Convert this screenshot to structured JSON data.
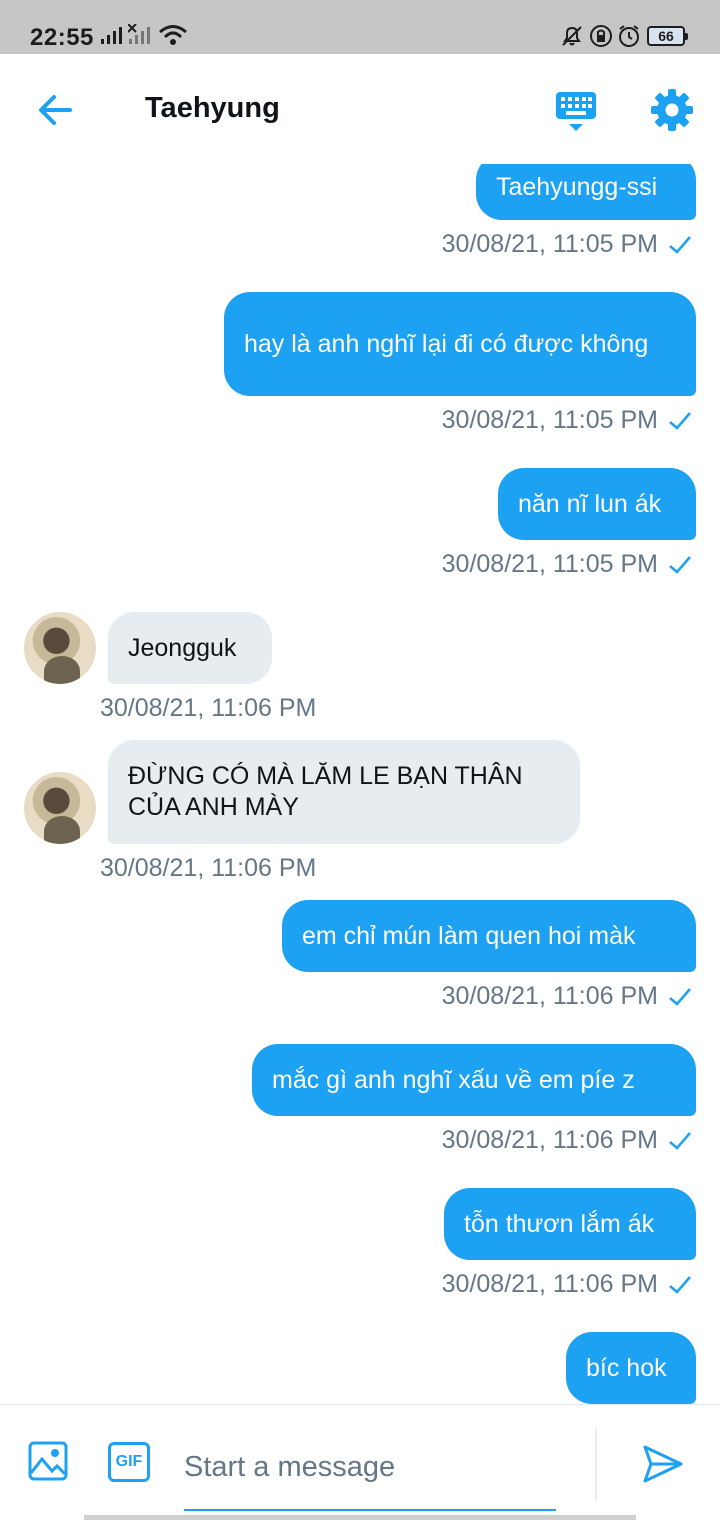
{
  "status_bar": {
    "time": "22:55",
    "battery": "66"
  },
  "header": {
    "title": "Taehyung"
  },
  "messages": [
    {
      "text": "Taehyungg-ssi",
      "time": "30/08/21, 11:05 PM"
    },
    {
      "text": "hay là anh nghĩ lại đi có được không",
      "time": "30/08/21, 11:05 PM"
    },
    {
      "text": "năn nĩ lun ák",
      "time": "30/08/21, 11:05 PM"
    },
    {
      "text": "Jeongguk",
      "time": "30/08/21, 11:06 PM"
    },
    {
      "text": "ĐỪNG CÓ MÀ LĂM LE BẠN THÂN CỦA ANH MÀY",
      "time": "30/08/21, 11:06 PM"
    },
    {
      "text": "em chỉ mún làm quen hoi màk",
      "time": "30/08/21, 11:06 PM"
    },
    {
      "text": "mắc gì anh nghĩ xấu về em píe z",
      "time": "30/08/21, 11:06 PM"
    },
    {
      "text": "tỗn thươn lắm ák",
      "time": "30/08/21, 11:06 PM"
    },
    {
      "text": "bíc hok"
    }
  ],
  "composer": {
    "placeholder": "Start a message",
    "gif_label": "GIF"
  },
  "colors": {
    "accent": "#1da1f2",
    "received_bubble": "#e6ecf0",
    "timestamp": "#657786"
  },
  "icons": [
    "back-arrow-icon",
    "keyboard-icon",
    "gear-icon",
    "image-icon",
    "gif-icon",
    "send-icon",
    "check-icon"
  ]
}
